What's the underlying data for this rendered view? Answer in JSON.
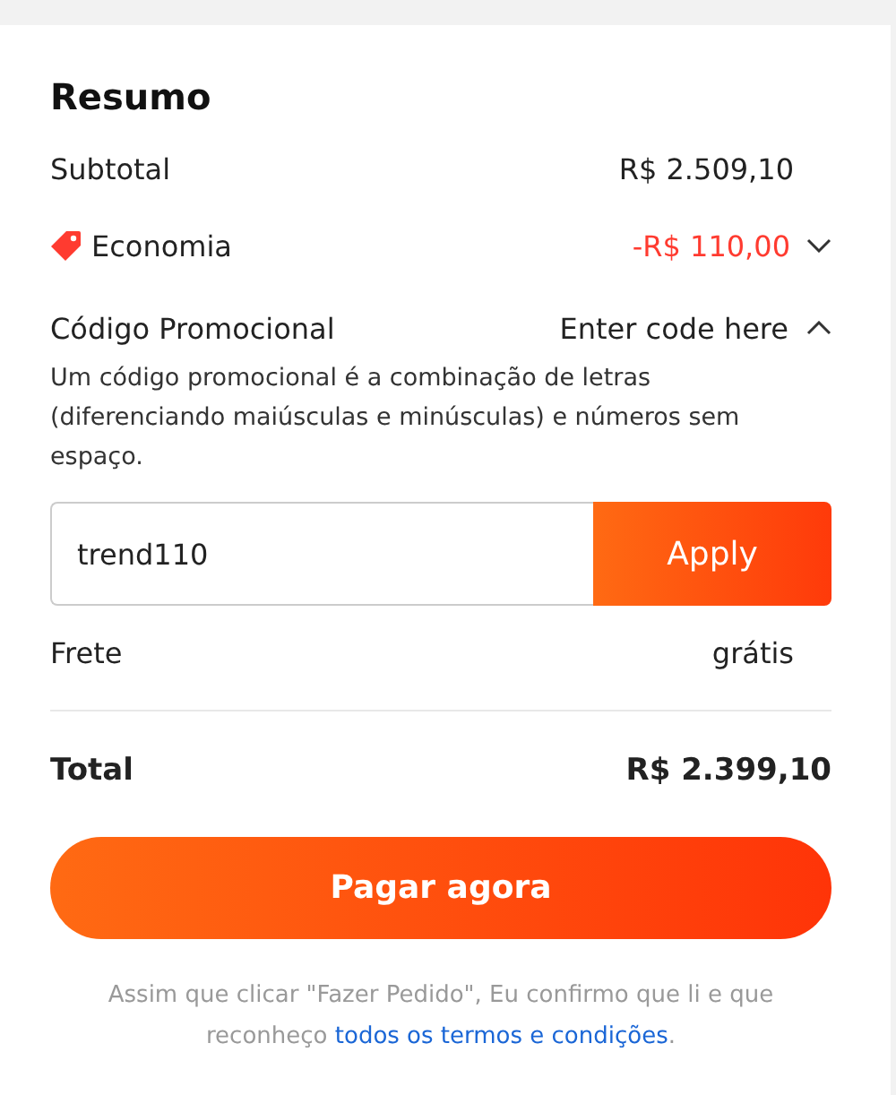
{
  "title": "Resumo",
  "subtotal": {
    "label": "Subtotal",
    "value": "R$ 2.509,10"
  },
  "savings": {
    "label": "Economia",
    "value": "-R$ 110,00",
    "expanded": false
  },
  "promo": {
    "label": "Código Promocional",
    "action": "Enter code here",
    "expanded": true,
    "description": "Um código promocional é a combinação de letras (diferenciando maiúsculas e minúsculas) e números sem espaço.",
    "value": "trend110",
    "apply": "Apply"
  },
  "shipping": {
    "label": "Frete",
    "value": "grátis"
  },
  "total": {
    "label": "Total",
    "value": "R$ 2.399,10"
  },
  "pay_button": "Pagar agora",
  "footer": {
    "text": "Assim que clicar \"Fazer Pedido\", Eu confirmo que li e que reconheço",
    "link": "todos os termos e condições",
    "end": "."
  }
}
